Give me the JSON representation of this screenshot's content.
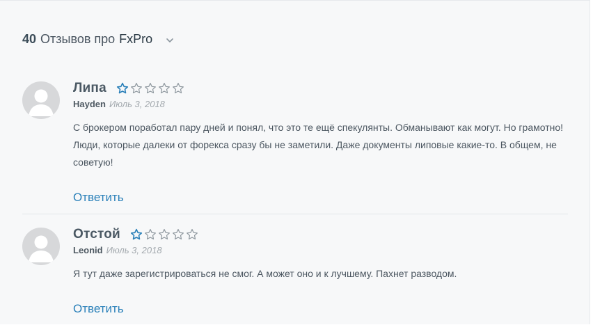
{
  "header": {
    "count": "40",
    "text": "Отзывов про",
    "brand": "FxPro",
    "chevron_icon": "chevron-down-icon"
  },
  "reviews": [
    {
      "title": "Липа",
      "rating": 1,
      "max_rating": 5,
      "author": "Hayden",
      "date": "Июль 3, 2018",
      "text": "С брокером поработал пару дней и понял, что это те ещё спекулянты. Обманывают как могут. Но грамотно! Люди, которые далеки от форекса сразу бы не заметили. Даже документы липовые какие-то. В общем, не советую!",
      "reply_label": "Ответить"
    },
    {
      "title": "Отстой",
      "rating": 1,
      "max_rating": 5,
      "author": "Leonid",
      "date": "Июль 3, 2018",
      "text": "Я тут даже зарегистрироваться не смог. А может оно и к лучшему. Пахнет разводом.",
      "reply_label": "Ответить"
    }
  ],
  "colors": {
    "star": "#2a80b9",
    "link": "#2a80b9",
    "background": "#f7f8f9"
  }
}
